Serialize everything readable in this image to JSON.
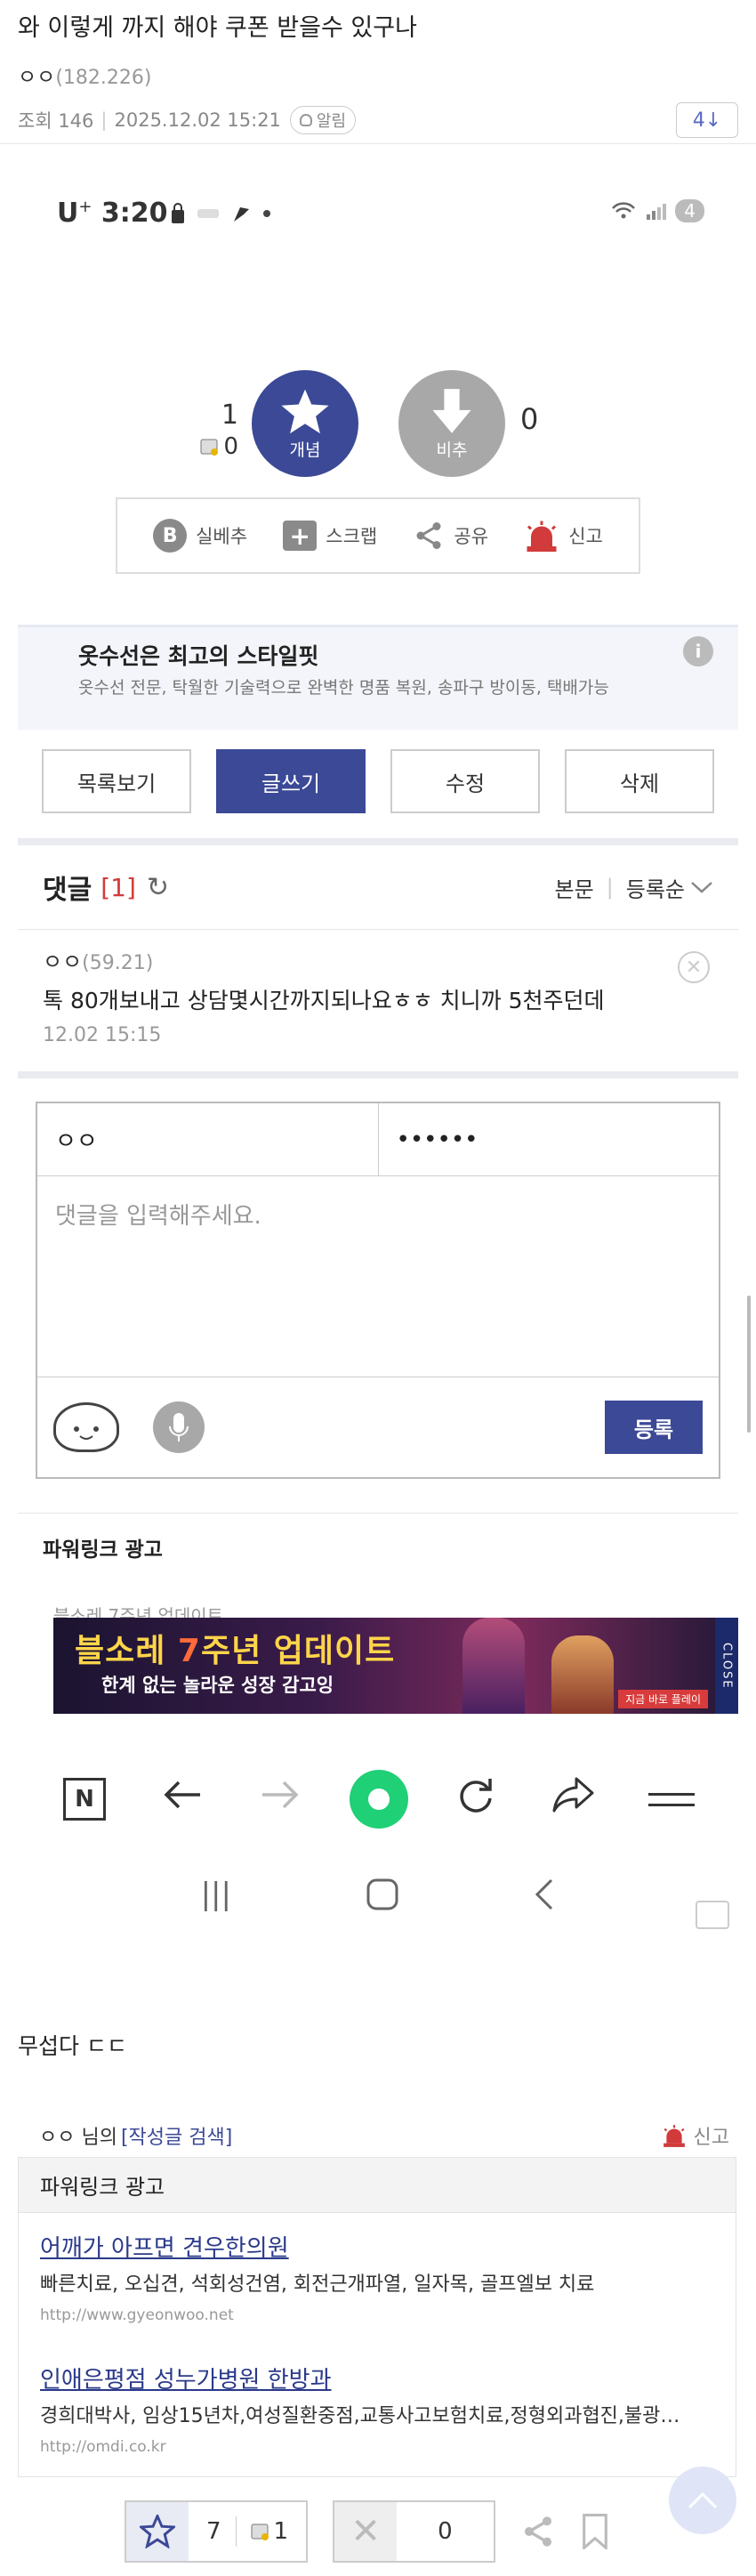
{
  "post": {
    "title": "와 이렇게 까지 해야 쿠폰 받을수 있구나",
    "author": "ㅇㅇ",
    "author_ip": "(182.226)",
    "views_label": "조회 146",
    "datetime": "2025.12.02 15:21",
    "alarm_label": "알림",
    "count_box": "4↓",
    "body_text": "무섭다 ㄷㄷ"
  },
  "screenshot_status": {
    "carrier": "U",
    "carrier_sup": "+",
    "time": "3:20",
    "battery": "4"
  },
  "votes": {
    "up_count": "1",
    "up_sub": "0",
    "up_label": "개념",
    "down_label": "비추",
    "down_count": "0"
  },
  "actions": {
    "best_label": "실베추",
    "scrap_label": "스크랩",
    "share_label": "공유",
    "report_label": "신고"
  },
  "ad": {
    "title": "옷수선은 최고의 스타일핏",
    "desc": "옷수선 전문, 탁월한 기술력으로 완벽한 명품 복원, 송파구 방이동, 택배가능"
  },
  "buttons": {
    "list": "목록보기",
    "write": "글쓰기",
    "edit": "수정",
    "delete": "삭제"
  },
  "comments": {
    "title": "댓글",
    "count": "[1]",
    "sort_body": "본문",
    "sort_order": "등록순",
    "items": [
      {
        "author": "ㅇㅇ",
        "ip": "(59.21)",
        "text": "톡 80개보내고 상담몇시간까지되나요ㅎㅎ 치니까 5천주던데",
        "time": "12.02 15:15"
      }
    ]
  },
  "write_form": {
    "nickname": "ㅇㅇ",
    "password": "••••••",
    "placeholder": "댓글을 입력해주세요.",
    "submit": "등록"
  },
  "powerlink": {
    "title": "파워링크 광고"
  },
  "banner": {
    "ghost_text": "블소레 7주년 업데이트",
    "headline_a": "블소레",
    "headline_num": "7",
    "headline_b": "주년 업데이트",
    "sub": "한계 없는 놀라운 성장 감고잉",
    "cta": "지금 바로 플레이",
    "close": "CLOSE"
  },
  "browser_nav": {
    "n_label": "N"
  },
  "author_row": {
    "name": "ㅇㅇ 님의",
    "search_link": "[작성글 검색]",
    "report": "신고"
  },
  "powerlink2": {
    "title": "파워링크 광고",
    "items": [
      {
        "title": "어깨가 아프면 견우한의원",
        "desc": "빠른치료, 오십견, 석회성건염, 회전근개파열, 일자목, 골프엘보 치료",
        "url": "http://www.gyeonwoo.net"
      },
      {
        "title": "인애은평점 성누가병원 한방과",
        "desc": "경희대박사, 임상15년차,여성질환중점,교통사고보험치료,정형외과협진,불광…",
        "url": "http://omdi.co.kr"
      }
    ]
  },
  "bottom_bar": {
    "up_count": "7",
    "up_sub": "1",
    "down_count": "0"
  },
  "colors": {
    "accent": "#3b4996",
    "red": "#d13b3b",
    "green": "#1fd076"
  }
}
